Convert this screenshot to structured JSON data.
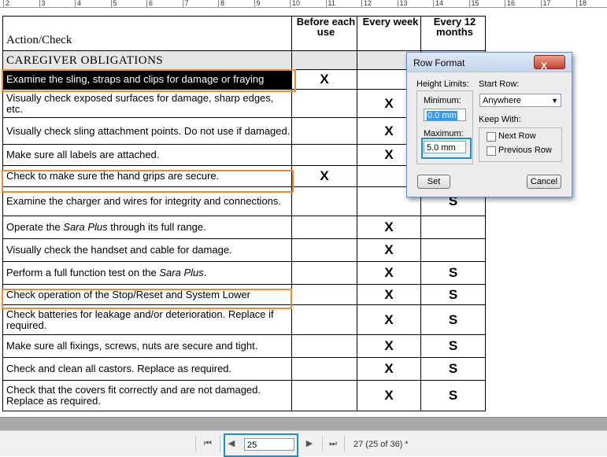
{
  "ruler": {
    "marks": [
      "2",
      "3",
      "4",
      "5",
      "6",
      "7",
      "8",
      "9",
      "10",
      "11",
      "12",
      "13",
      "14",
      "15",
      "16",
      "17",
      "18"
    ]
  },
  "table": {
    "headers": {
      "action": "Action/Check",
      "before_use": "Before each use",
      "every_week": "Every week",
      "every_12_months": "Every 12 months"
    },
    "section_title": "CAREGIVER OBLIGATIONS",
    "rows": [
      {
        "text": "Examine the sling, straps and clips for damage or fraying",
        "before": "X",
        "week": "",
        "months": ""
      },
      {
        "text": "Visually check exposed surfaces for damage, sharp edges, etc.",
        "before": "",
        "week": "X",
        "months": ""
      },
      {
        "text": "Visually check sling attachment points. Do not use if damaged.",
        "before": "",
        "week": "X",
        "months": ""
      },
      {
        "text": "Make sure all labels are attached.",
        "before": "",
        "week": "X",
        "months": ""
      },
      {
        "text": "Check to make sure the hand grips are secure.",
        "before": "X",
        "week": "",
        "months": ""
      },
      {
        "text": "Examine the charger and wires for integrity and connections.",
        "before": "",
        "week": "",
        "months": "S"
      },
      {
        "pre": "Operate the ",
        "em": "Sara Plus",
        "post": " through its full range.",
        "before": "",
        "week": "X",
        "months": ""
      },
      {
        "text": "Visually check the handset and cable for damage.",
        "before": "",
        "week": "X",
        "months": ""
      },
      {
        "pre": "Perform a full function test on the ",
        "em": "Sara Plus",
        "post": ".",
        "before": "",
        "week": "X",
        "months": "S"
      },
      {
        "text": "Check operation of the Stop/Reset and System Lower",
        "before": "",
        "week": "X",
        "months": "S"
      },
      {
        "text": "Check batteries for leakage and/or deterioration. Replace if required.",
        "before": "",
        "week": "X",
        "months": "S"
      },
      {
        "text": "Make sure all fixings, screws, nuts are secure and tight.",
        "before": "",
        "week": "X",
        "months": "S"
      },
      {
        "text": "Check and clean all castors. Replace as required.",
        "before": "",
        "week": "X",
        "months": "S"
      },
      {
        "text": "Check that the covers fit correctly and are not damaged. Replace as required.",
        "before": "",
        "week": "X",
        "months": "S"
      }
    ]
  },
  "dialog": {
    "title": "Row Format",
    "close_label": "X",
    "height_limits_label": "Height Limits:",
    "minimum_label": "Minimum:",
    "minimum_value": "0.0 mm",
    "maximum_label": "Maximum:",
    "maximum_value": "5.0 mm",
    "start_row_label": "Start Row:",
    "start_row_value": "Anywhere",
    "keep_with_label": "Keep With:",
    "next_row_label": "Next Row",
    "previous_row_label": "Previous Row",
    "set_button": "Set",
    "cancel_button": "Cancel"
  },
  "navigation": {
    "page_value": "25",
    "status": "27 (25 of 36) *",
    "first_icon": "first-page-icon",
    "prev_icon": "previous-page-icon",
    "next_icon": "next-page-icon",
    "last_icon": "last-page-icon"
  },
  "colors": {
    "highlight_box": "#f0892f",
    "focus_box": "#1a8fd6",
    "selected_row": "#000000"
  }
}
